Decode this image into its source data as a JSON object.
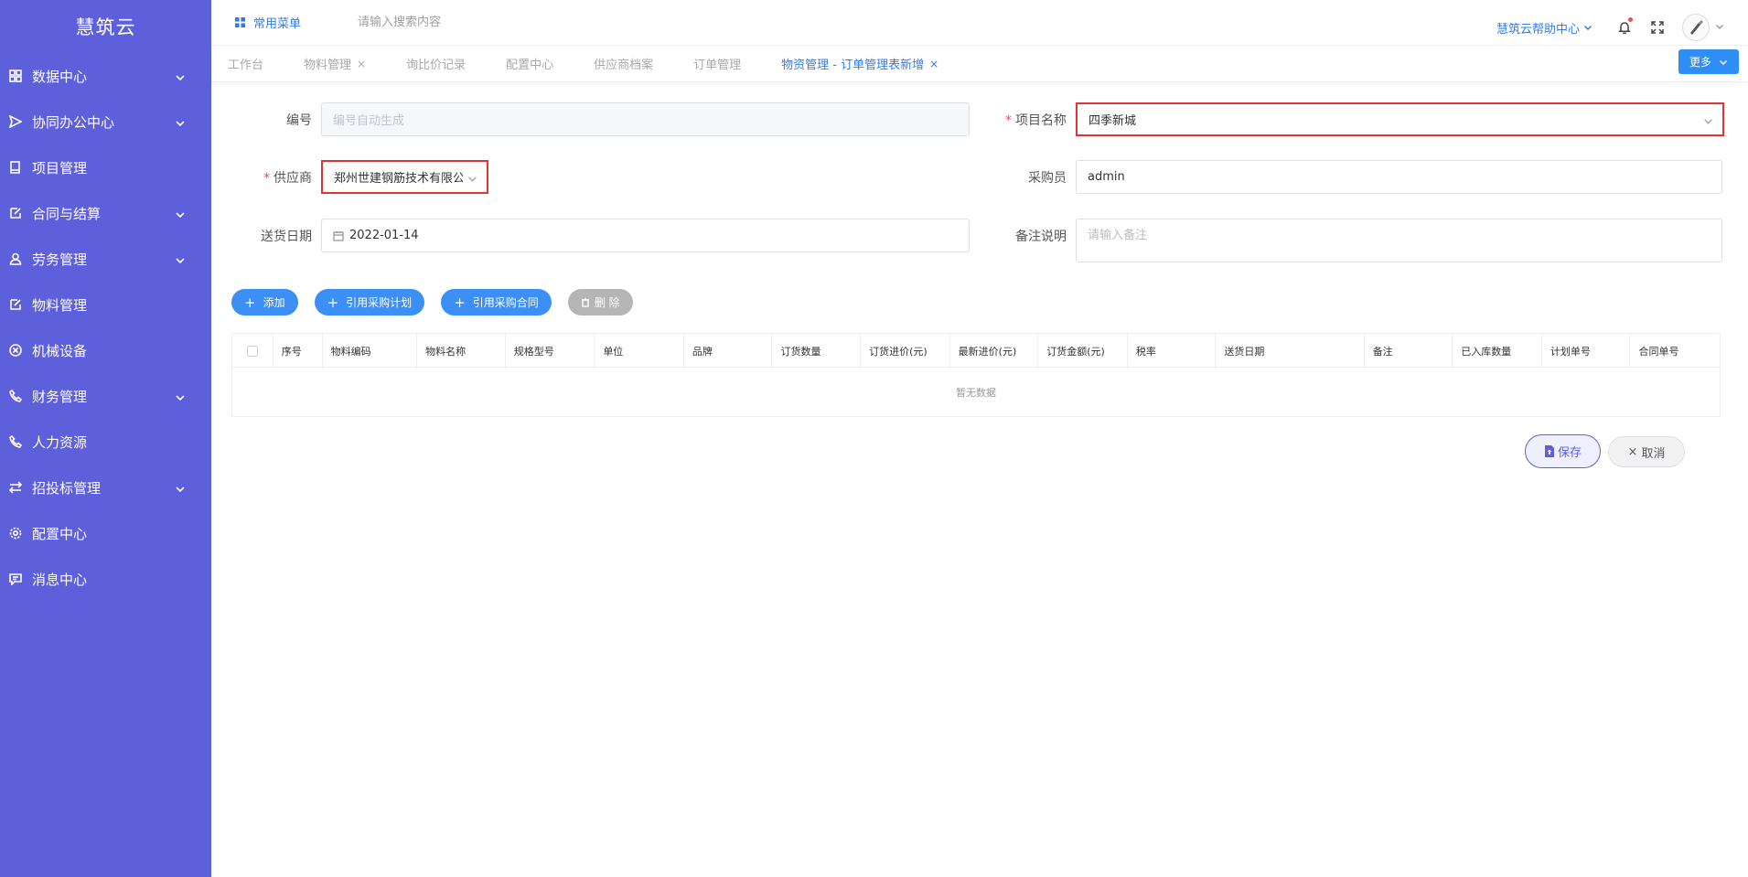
{
  "app": {
    "logo": "慧筑云"
  },
  "sidebar": {
    "items": [
      {
        "label": "数据中心",
        "icon": "grid-icon",
        "expandable": true
      },
      {
        "label": "协同办公中心",
        "icon": "send-icon",
        "expandable": true
      },
      {
        "label": "项目管理",
        "icon": "book-icon",
        "expandable": false
      },
      {
        "label": "合同与结算",
        "icon": "edit-icon",
        "expandable": true
      },
      {
        "label": "劳务管理",
        "icon": "user-icon",
        "expandable": true
      },
      {
        "label": "物料管理",
        "icon": "edit-icon",
        "expandable": false
      },
      {
        "label": "机械设备",
        "icon": "close-circle-icon",
        "expandable": false
      },
      {
        "label": "财务管理",
        "icon": "phone-icon",
        "expandable": true
      },
      {
        "label": "人力资源",
        "icon": "phone-icon",
        "expandable": false
      },
      {
        "label": "招投标管理",
        "icon": "swap-icon",
        "expandable": true
      },
      {
        "label": "配置中心",
        "icon": "gear-icon",
        "expandable": false
      },
      {
        "label": "消息中心",
        "icon": "message-icon",
        "expandable": false
      }
    ]
  },
  "header": {
    "fav_menu": "常用菜单",
    "search_placeholder": "请输入搜索内容",
    "help": "慧筑云帮助中心"
  },
  "tabs": {
    "items": [
      {
        "label": "工作台",
        "closable": false,
        "active": false
      },
      {
        "label": "物料管理",
        "closable": true,
        "active": false
      },
      {
        "label": "询比价记录",
        "closable": false,
        "active": false
      },
      {
        "label": "配置中心",
        "closable": false,
        "active": false
      },
      {
        "label": "供应商档案",
        "closable": false,
        "active": false
      },
      {
        "label": "订单管理",
        "closable": false,
        "active": false
      },
      {
        "label": "物资管理 - 订单管理表新增",
        "closable": true,
        "active": true
      }
    ],
    "close_glyph": "×",
    "more": "更多"
  },
  "form": {
    "number": {
      "label": "编号",
      "placeholder": "编号自动生成"
    },
    "project": {
      "label": "项目名称",
      "value": "四季新城"
    },
    "supplier": {
      "label": "供应商",
      "value": "郑州世建钢筋技术有限公"
    },
    "buyer": {
      "label": "采购员",
      "value": "admin"
    },
    "delivery_date": {
      "label": "送货日期",
      "value": "2022-01-14"
    },
    "remark": {
      "label": "备注说明",
      "placeholder": "请输入备注"
    },
    "required_mark": "*"
  },
  "actions": {
    "add": "添加",
    "ref_plan": "引用采购计划",
    "ref_contract": "引用采购合同",
    "delete": "删 除"
  },
  "table": {
    "columns": [
      "序号",
      "物料编码",
      "物料名称",
      "规格型号",
      "单位",
      "品牌",
      "订货数量",
      "订货进价(元)",
      "最新进价(元)",
      "订货金额(元)",
      "税率",
      "送货日期",
      "备注",
      "已入库数量",
      "计划单号",
      "合同单号"
    ],
    "empty": "暂无数据"
  },
  "footer": {
    "save": "保存",
    "cancel": "取消"
  },
  "colors": {
    "sidebar": "#5d5fdb",
    "accent": "#2f7cf0",
    "button": "#3c8ff5",
    "highlight": "#e13333"
  }
}
